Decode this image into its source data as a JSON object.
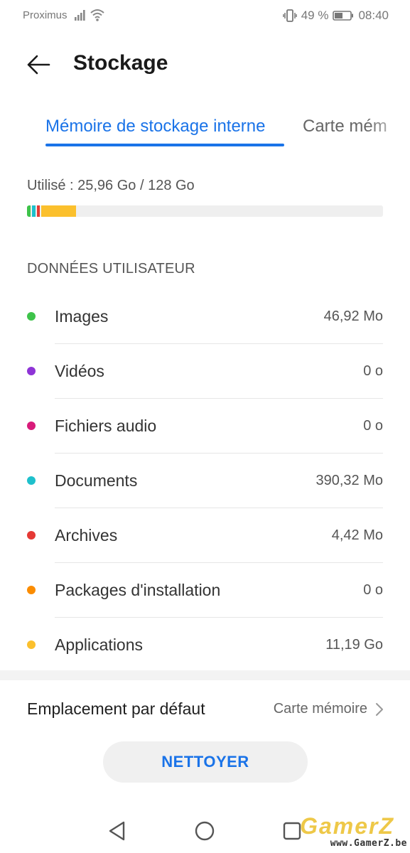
{
  "status_bar": {
    "carrier": "Proximus",
    "battery_percent": "49 %",
    "time": "08:40",
    "icons": [
      "signal-icon",
      "wifi-icon",
      "vibrate-icon",
      "battery-icon"
    ]
  },
  "header": {
    "title": "Stockage",
    "back_icon": "arrow-left-icon"
  },
  "tabs": [
    {
      "label": "Mémoire de stockage interne",
      "active": true
    },
    {
      "label": "Carte mém",
      "active": false
    }
  ],
  "usage": {
    "text": "Utilisé : 25,96 Go / 128 Go",
    "used_fraction": 0.2028,
    "segment_colors": [
      "#3ec34a",
      "#1ec0cc",
      "#e53935",
      "#fbc02d"
    ],
    "track_color": "#efefef"
  },
  "user_data": {
    "section_title": "DONNÉES UTILISATEUR",
    "items": [
      {
        "label": "Images",
        "value": "46,92 Mo",
        "color": "#3ec34a"
      },
      {
        "label": "Vidéos",
        "value": "0 o",
        "color": "#8e34d6"
      },
      {
        "label": "Fichiers audio",
        "value": "0 o",
        "color": "#d81b7a"
      },
      {
        "label": "Documents",
        "value": "390,32 Mo",
        "color": "#1ec0cc"
      },
      {
        "label": "Archives",
        "value": "4,42 Mo",
        "color": "#e53935"
      },
      {
        "label": "Packages d'installation",
        "value": "0 o",
        "color": "#fb8c00"
      },
      {
        "label": "Applications",
        "value": "11,19 Go",
        "color": "#fbc02d"
      }
    ]
  },
  "default_location": {
    "label": "Emplacement par défaut",
    "value": "Carte mémoire",
    "chevron_icon": "chevron-right-icon"
  },
  "clean_button": {
    "label": "NETTOYER"
  },
  "nav_bar": {
    "icons": [
      "nav-back-icon",
      "nav-home-icon",
      "nav-recent-icon"
    ]
  },
  "watermark": {
    "logo_text": "GamerZ",
    "url": "www.GamerZ.be"
  },
  "colors": {
    "accent": "#1a73e8"
  }
}
